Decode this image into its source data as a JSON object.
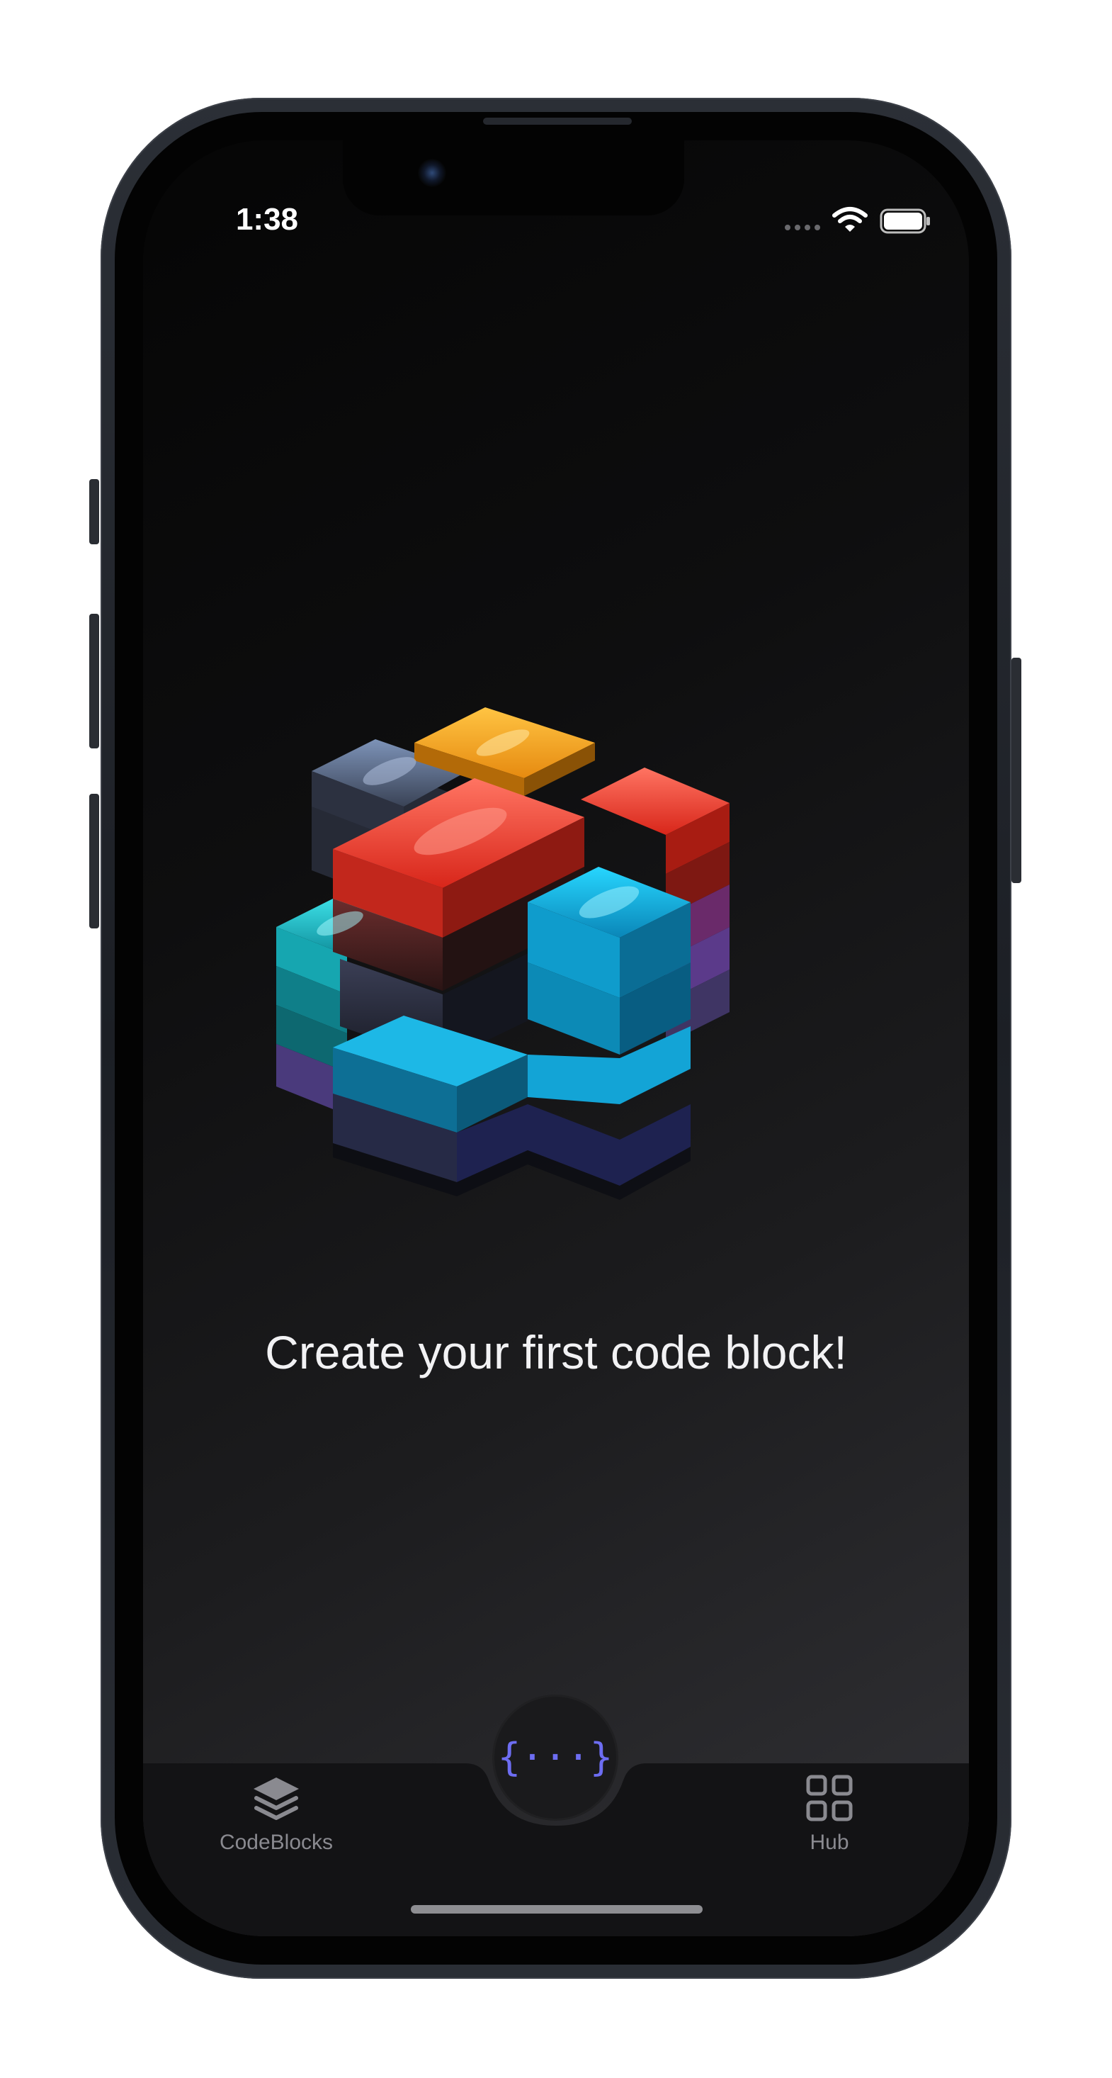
{
  "status_bar": {
    "time": "1:38"
  },
  "main": {
    "hero_icon": "stacked-code-blocks-illustration",
    "headline": "Create your first code block!"
  },
  "tab_bar": {
    "tabs": [
      {
        "label": "CodeBlocks",
        "icon": "layers-icon",
        "color": "#8a8a90"
      },
      {
        "label": "Hub",
        "icon": "grid-icon",
        "color": "#8a8a90"
      }
    ],
    "center_button": {
      "glyph": "{···}",
      "icon": "code-braces-icon",
      "color": "#6d6df2"
    }
  },
  "colors": {
    "background_dark": "#050505",
    "background_light": "#323236",
    "accent": "#6d6df2",
    "text_primary": "#f2f2f4",
    "tab_inactive": "#8a8a90"
  }
}
